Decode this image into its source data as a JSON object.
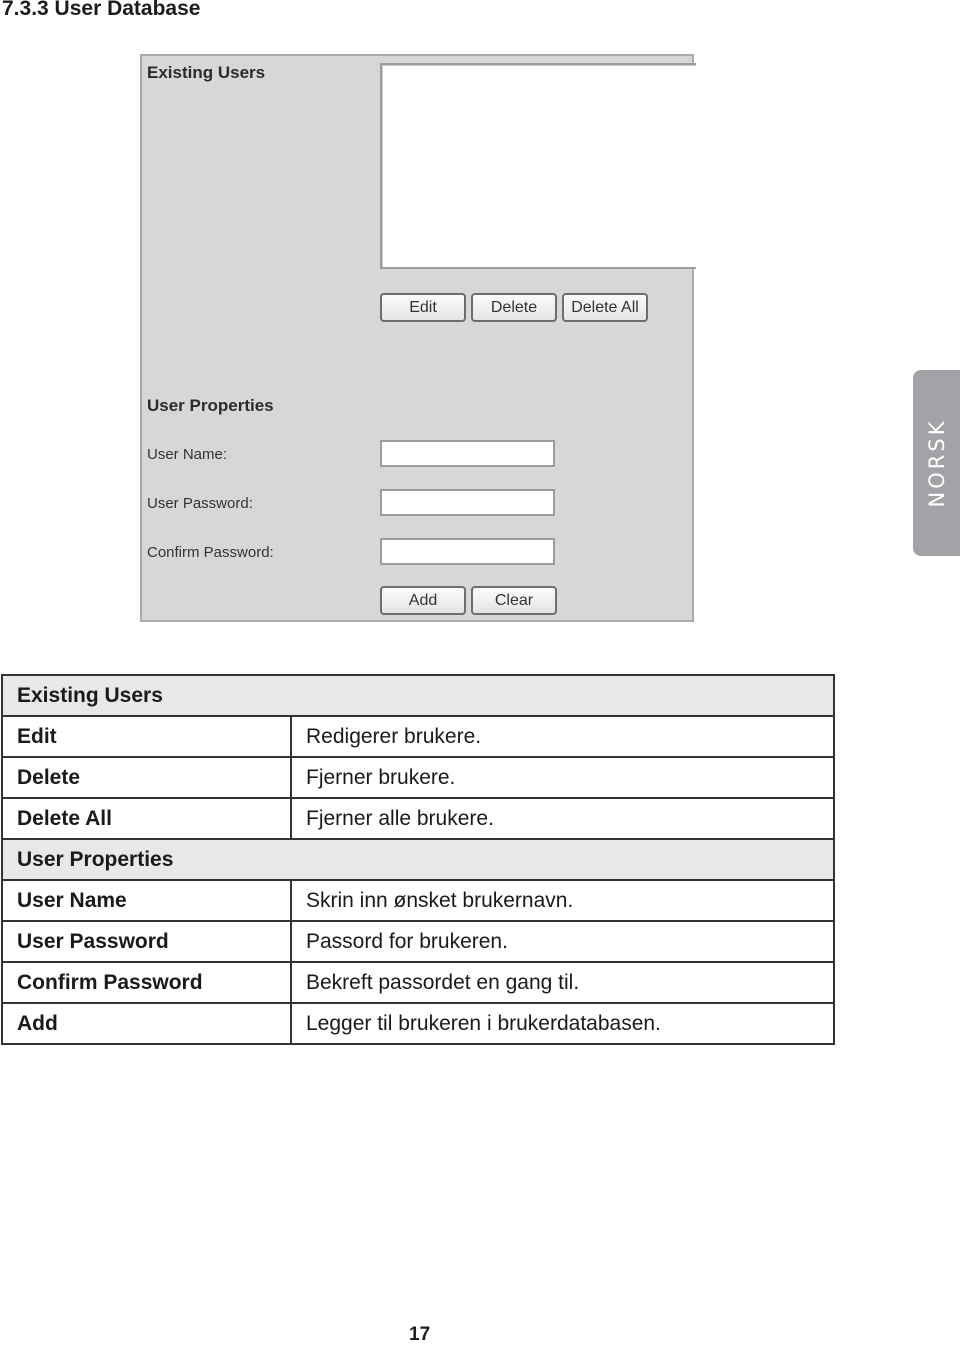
{
  "section_heading": "7.3.3 User Database",
  "panel": {
    "existing_users_title": "Existing Users",
    "existing_users_list": [],
    "buttons": {
      "edit": "Edit",
      "delete": "Delete",
      "delete_all": "Delete All",
      "add": "Add",
      "clear": "Clear"
    },
    "user_properties_title": "User Properties",
    "fields": {
      "user_name": {
        "label": "User Name:",
        "value": ""
      },
      "user_password": {
        "label": "User Password:",
        "value": ""
      },
      "confirm_password": {
        "label": "Confirm Password:",
        "value": ""
      }
    }
  },
  "side_tab": {
    "label": "NORSK"
  },
  "table": {
    "groups": [
      {
        "title": "Existing Users",
        "rows": [
          {
            "term": "Edit",
            "description": "Redigerer brukere."
          },
          {
            "term": "Delete",
            "description": "Fjerner brukere."
          },
          {
            "term": "Delete All",
            "description": "Fjerner alle brukere."
          }
        ]
      },
      {
        "title": "User Properties",
        "rows": [
          {
            "term": "User Name",
            "description": "Skrin inn ønsket brukernavn."
          },
          {
            "term": "User Password",
            "description": "Passord for brukeren."
          },
          {
            "term": "Confirm Password",
            "description": "Bekreft passordet en gang til."
          },
          {
            "term": "Add",
            "description": "Legger til brukeren i brukerdatabasen."
          }
        ]
      }
    ]
  },
  "page_number": "17"
}
